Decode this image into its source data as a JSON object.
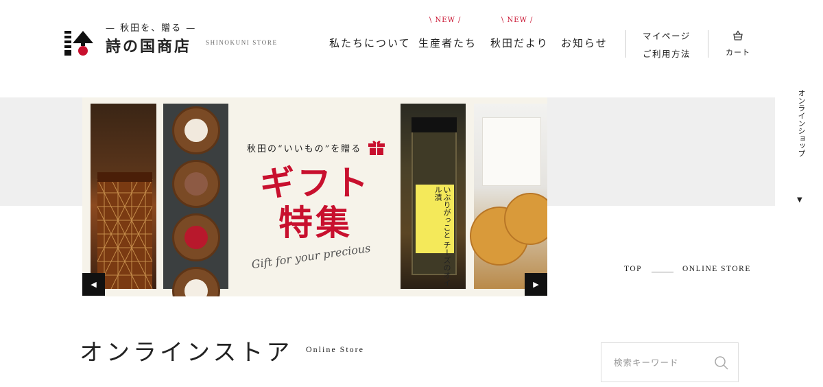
{
  "header": {
    "logo_tag": "— 秋田を、贈る —",
    "logo_name": "詩の国商店",
    "logo_sub": "SHINOKUNI STORE",
    "nav": [
      {
        "label": "私たちについて",
        "badge": ""
      },
      {
        "label": "生産者たち",
        "badge": "\\ NEW /"
      },
      {
        "label": "秋田だより",
        "badge": "\\ NEW /"
      },
      {
        "label": "お知らせ",
        "badge": ""
      }
    ],
    "mypage": "マイページ",
    "howto": "ご利用方法",
    "cart": "カート"
  },
  "side_label": "オンラインショップ",
  "banner": {
    "catch": "秋田の“いいもの”を贈る",
    "title_line1": "ギフト",
    "title_line2": "特集",
    "script": "Gift for your precious",
    "jar_text": "いぶりがっこと チーズのオイル漬",
    "accent_color": "#c8102e"
  },
  "breadcrumb": {
    "top": "TOP",
    "current": "ONLINE STORE"
  },
  "page": {
    "title": "オンラインストア",
    "subtitle": "Online Store"
  },
  "search": {
    "placeholder": "検索キーワード"
  }
}
